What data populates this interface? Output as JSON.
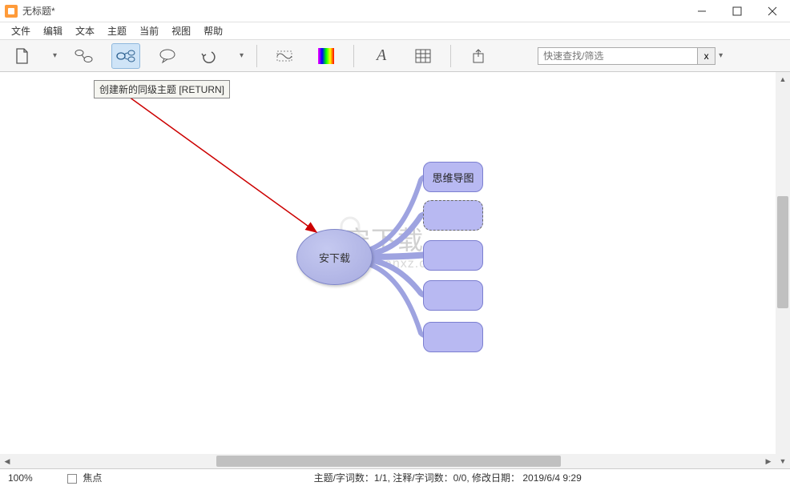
{
  "window": {
    "title": "无标题*"
  },
  "menubar": {
    "items": [
      "文件",
      "编辑",
      "文本",
      "主题",
      "当前",
      "视图",
      "帮助"
    ]
  },
  "toolbar": {
    "tooltip_text": "创建新的同级主题 [RETURN]",
    "search_placeholder": "快速查找/筛选",
    "clear_label": "x"
  },
  "mindmap": {
    "root_label": "安下载",
    "children": [
      {
        "label": "思维导图",
        "selected": false
      },
      {
        "label": "",
        "selected": true
      },
      {
        "label": "",
        "selected": false
      },
      {
        "label": "",
        "selected": false
      },
      {
        "label": "",
        "selected": false
      }
    ],
    "watermark_main": "安下载",
    "watermark_sub": "anxz.com"
  },
  "statusbar": {
    "zoom": "100%",
    "focus_label": "焦点",
    "topic_word_count": "主题/字词数：1/1,",
    "note_word_count": "注释/字词数：0/0,",
    "modified_label": "修改日期：",
    "modified_date": "2019/6/4 9:29"
  }
}
